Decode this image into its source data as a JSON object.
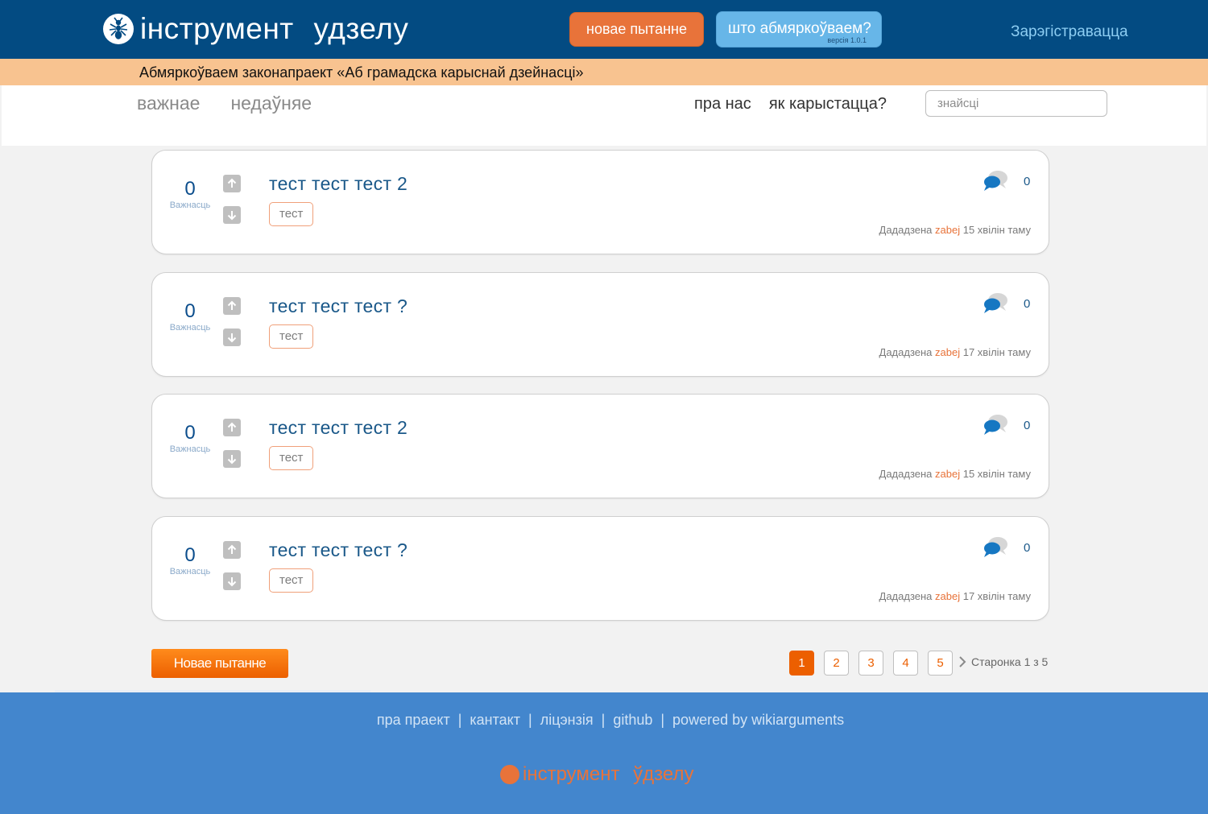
{
  "header": {
    "logo_text": "інструмент  удзелу",
    "new_question_label": "новае пытанне",
    "discuss_label": "што абмяркоўваем?",
    "version": "версія 1.0.1",
    "register_label": "Зарэгістравацца"
  },
  "banner": {
    "text": "Абмяркоўваем законапраект «Аб грамадска карыснай дзейнасці»"
  },
  "nav": {
    "left": [
      "важнае",
      "недаўняе"
    ],
    "right": [
      "пра нас",
      "як карыстацца?"
    ],
    "search_placeholder": "знайсці"
  },
  "questions": [
    {
      "score": "0",
      "score_label": "Важнасць",
      "title": "тест тест тест 2",
      "tag": "тест",
      "comments": "0",
      "added": "Дададзена",
      "author": "zabej",
      "time": "15 хвілін таму"
    },
    {
      "score": "0",
      "score_label": "Важнасць",
      "title": "тест тест тест ?",
      "tag": "тест",
      "comments": "0",
      "added": "Дададзена",
      "author": "zabej",
      "time": "17 хвілін таму"
    },
    {
      "score": "0",
      "score_label": "Важнасць",
      "title": "тест тест тест 2",
      "tag": "тест",
      "comments": "0",
      "added": "Дададзена",
      "author": "zabej",
      "time": "15 хвілін таму"
    },
    {
      "score": "0",
      "score_label": "Важнасць",
      "title": "тест тест тест ?",
      "tag": "тест",
      "comments": "0",
      "added": "Дададзена",
      "author": "zabej",
      "time": "17 хвілін таму"
    }
  ],
  "bottom": {
    "new_question_label": "Новае пытанне",
    "pages": [
      "1",
      "2",
      "3",
      "4",
      "5"
    ],
    "page_info": "Старонка 1 з 5"
  },
  "footer": {
    "links": [
      "пра праект",
      "кантакт",
      "ліцэнзія",
      "github",
      "powered by wikiarguments"
    ],
    "separator": "|",
    "logo_text": "інструмент  ўдзелу"
  },
  "colors": {
    "header_bg": "#034b82",
    "banner_bg": "#f8c390",
    "accent_orange": "#e8733a",
    "accent_blue": "#67b6e8",
    "footer_bg": "#4386cd"
  }
}
